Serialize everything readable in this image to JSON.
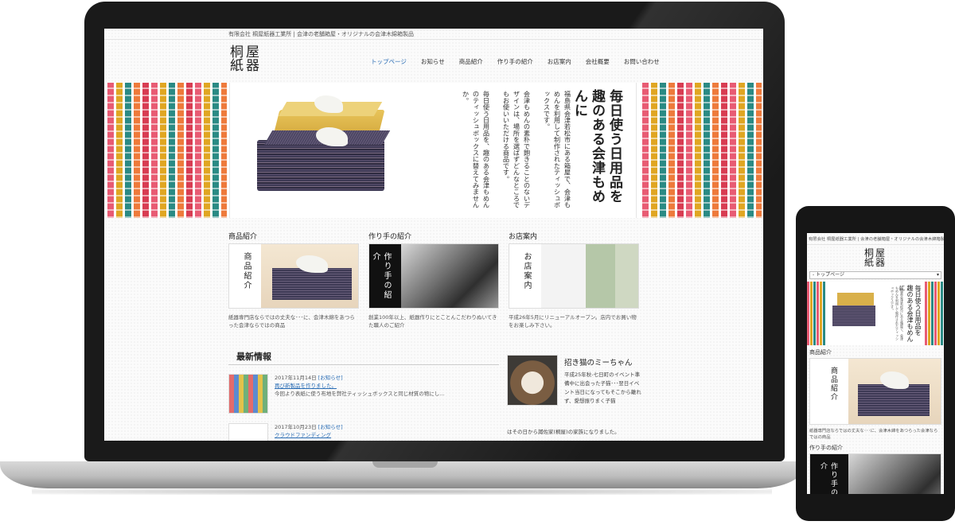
{
  "site": {
    "topbar": "有限会社 桐屋紙器工業所 | 会津の老舗箱屋・オリジナルの会津木綿箱製品",
    "logo_line1": "桐屋",
    "logo_line2": "紙器"
  },
  "nav": {
    "items": [
      "トップページ",
      "お知らせ",
      "商品紹介",
      "作り手の紹介",
      "お店案内",
      "会社概要",
      "お問い合わせ"
    ]
  },
  "hero": {
    "title": "毎日使う日用品を 趣のある会津もめんに",
    "paragraphs": [
      "福島県会津若松市にある箱屋で、会津もめんを利用して制作されたティッシュボックスです。",
      "会津もめんの素朴で飽きることのないデザインは、場所を選ばずどんなところでもお使いいただける商品です。",
      "毎日使う日用品を、趣のある会津もめんのティッシュボックスに替えてみませんか。"
    ]
  },
  "cards": [
    {
      "heading": "商品紹介",
      "label": "商品紹介",
      "desc": "紙器専門店ならではの丈夫な･･･に、会津木綿をあつらった会津ならではの商品"
    },
    {
      "heading": "作り手の紹介",
      "label": "作り手の紹介",
      "desc": "創業100年以上、紙器作りにとことんこだわりぬいてきた職人のご紹介"
    },
    {
      "heading": "お店案内",
      "label": "お店案内",
      "desc": "平成26年5月にリニューアルオープン。店内でお買い物をお楽しみ下さい。"
    }
  ],
  "news": {
    "title": "最新情報",
    "items": [
      {
        "date": "2017年11月14日",
        "category": "[お知らせ]",
        "headline": "再び新製品を作りました。",
        "excerpt": "今回より表紙に使う布地を弊社ティッシュボックスと同じ材質の物にし..."
      },
      {
        "date": "2017年10月23日",
        "category": "[お知らせ]",
        "headline": "クラウドファンディング",
        "excerpt": ""
      }
    ]
  },
  "cat": {
    "title": "招き猫のミーちゃん",
    "text": "平成25年秋-七日町のイベント準備中に出会った子猫･･･翌日イベント当日になってもそこから離れず、愛想振りまく子猫",
    "more": "はその日から諏佐家(桐屋)の家族になりました。"
  },
  "phone": {
    "topbar": "有限会社 桐屋紙器工業所 | 会津の老舗箱屋・オリジナルの会津木綿箱製品",
    "select_value": "- トップページ",
    "hero_title": "毎日使う日用品を 趣のある会津もめんに",
    "hero_text": "福島県会津若松市にある箱屋で、会津もめんを利用して制作されたティッシュボックスです。",
    "section1": "商品紹介",
    "card1_label": "商品紹介",
    "card1_desc": "紙器専門店ならではの丈夫な･･･に、会津木綿をあつらった会津ならではの商品",
    "section2": "作り手の紹介",
    "card2_label": "作り手の紹介"
  }
}
